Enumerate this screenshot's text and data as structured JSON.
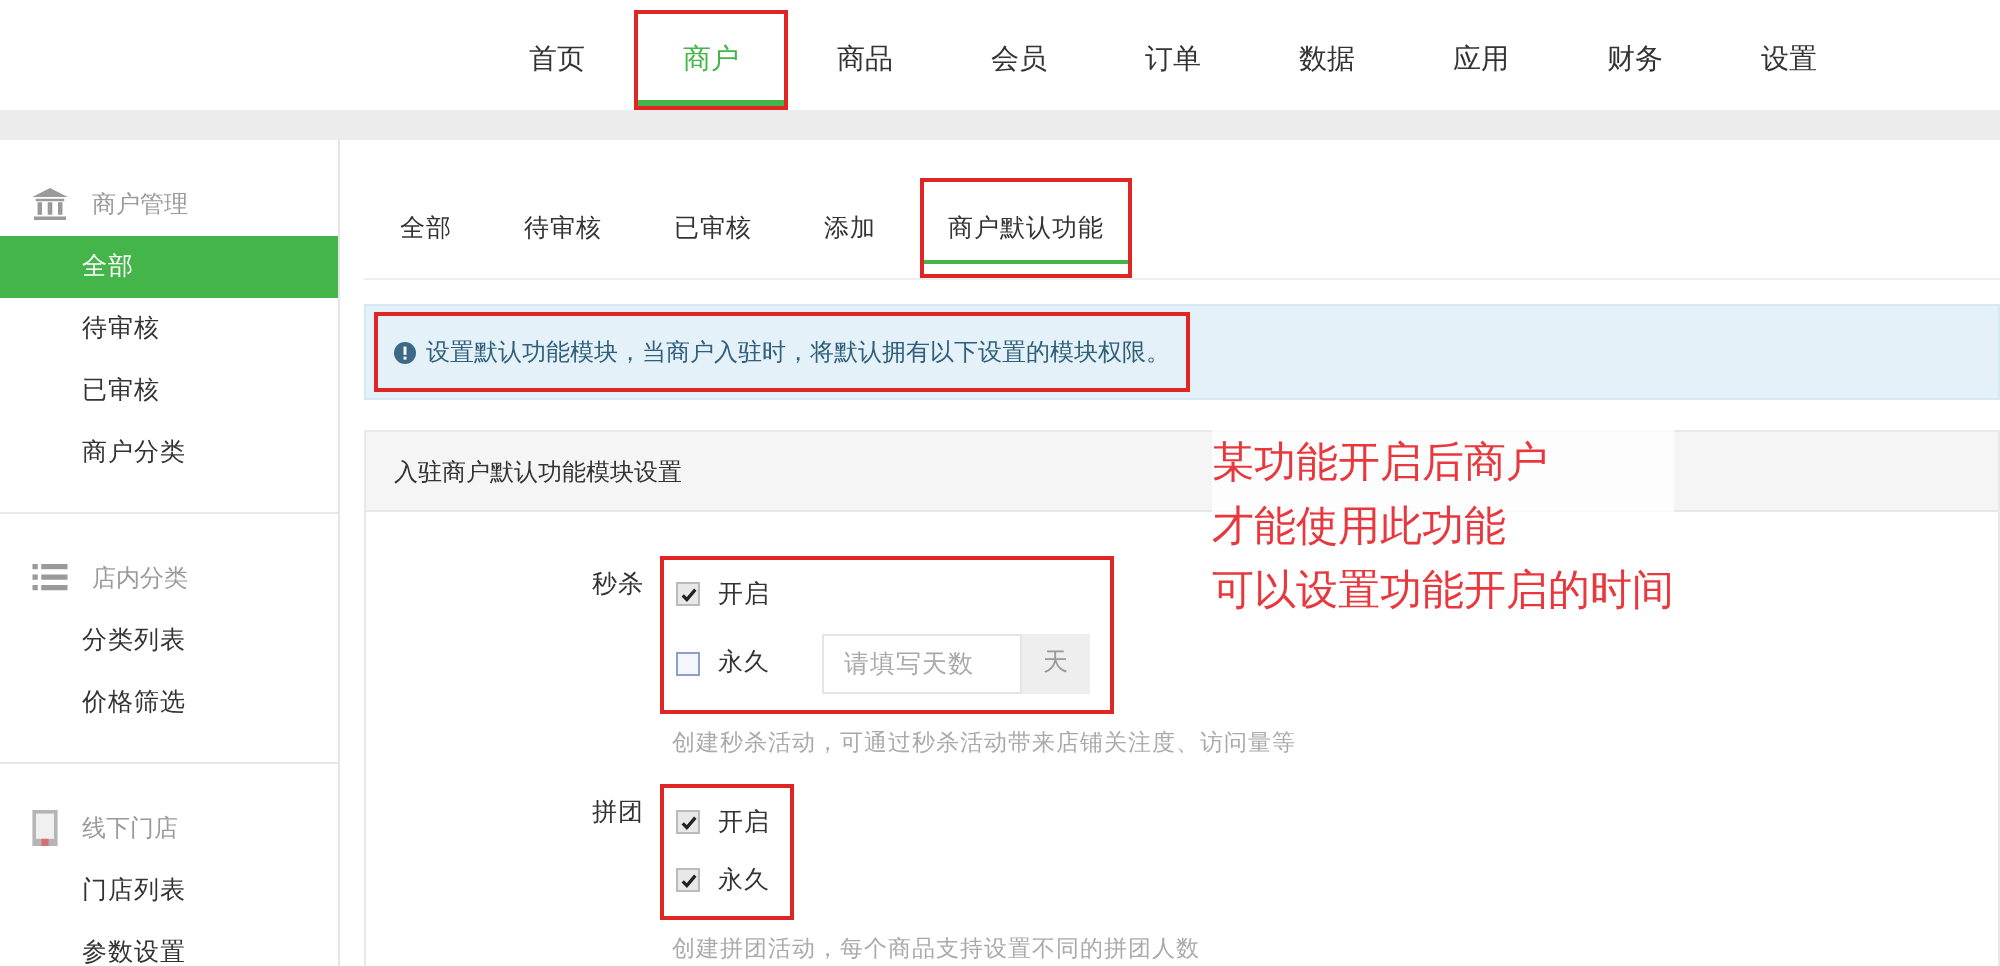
{
  "top_nav": [
    {
      "label": "首页",
      "selected": false,
      "highlighted": false
    },
    {
      "label": "商户",
      "selected": true,
      "highlighted": true
    },
    {
      "label": "商品",
      "selected": false,
      "highlighted": false
    },
    {
      "label": "会员",
      "selected": false,
      "highlighted": false
    },
    {
      "label": "订单",
      "selected": false,
      "highlighted": false
    },
    {
      "label": "数据",
      "selected": false,
      "highlighted": false
    },
    {
      "label": "应用",
      "selected": false,
      "highlighted": false
    },
    {
      "label": "财务",
      "selected": false,
      "highlighted": false
    },
    {
      "label": "设置",
      "selected": false,
      "highlighted": false
    }
  ],
  "sidebar": {
    "sections": [
      {
        "title": "商户管理",
        "items": [
          {
            "label": "全部",
            "selected": true
          },
          {
            "label": "待审核",
            "selected": false
          },
          {
            "label": "已审核",
            "selected": false
          },
          {
            "label": "商户分类",
            "selected": false
          }
        ]
      },
      {
        "title": "店内分类",
        "items": [
          {
            "label": "分类列表",
            "selected": false
          },
          {
            "label": "价格筛选",
            "selected": false
          }
        ]
      },
      {
        "title": "线下门店",
        "items": [
          {
            "label": "门店列表",
            "selected": false
          },
          {
            "label": "参数设置",
            "selected": false
          }
        ]
      }
    ]
  },
  "tabs": [
    {
      "label": "全部",
      "selected": false,
      "highlighted": false
    },
    {
      "label": "待审核",
      "selected": false,
      "highlighted": false
    },
    {
      "label": "已审核",
      "selected": false,
      "highlighted": false
    },
    {
      "label": "添加",
      "selected": false,
      "highlighted": false
    },
    {
      "label": "商户默认功能",
      "selected": true,
      "highlighted": true
    }
  ],
  "alert": {
    "text": "设置默认功能模块，当商户入驻时，将默认拥有以下设置的模块权限。",
    "highlighted": true
  },
  "panel": {
    "title": "入驻商户默认功能模块设置",
    "modules": [
      {
        "label": "秒杀",
        "highlighted": true,
        "enable": {
          "label": "开启",
          "checked": true
        },
        "permanent": {
          "label": "永久",
          "checked": false
        },
        "days": {
          "placeholder": "请填写天数",
          "unit": "天"
        },
        "help": "创建秒杀活动，可通过秒杀活动带来店铺关注度、访问量等"
      },
      {
        "label": "拼团",
        "highlighted": true,
        "enable": {
          "label": "开启",
          "checked": true
        },
        "permanent": {
          "label": "永久",
          "checked": true
        },
        "help": "创建拼团活动，每个商品支持设置不同的拼团人数"
      }
    ]
  },
  "annotation": [
    "某功能开启后商户",
    "才能使用此功能",
    "可以设置功能开启的时间"
  ]
}
